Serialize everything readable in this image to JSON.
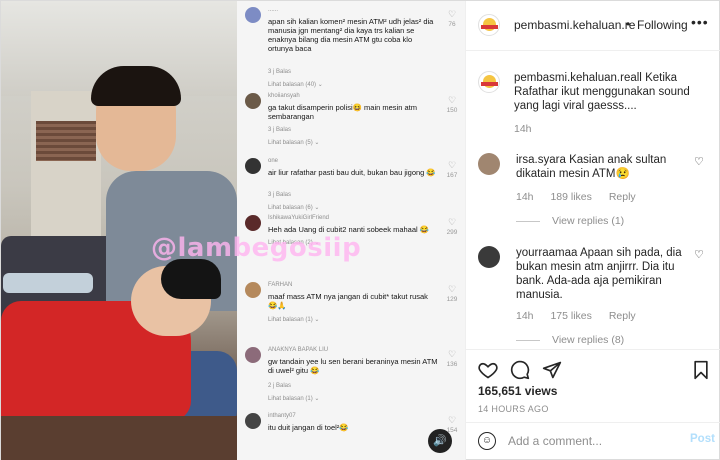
{
  "video": {
    "watermark": "@lambegosiip",
    "comments": [
      {
        "name": "......",
        "text": "apan sih kalian komen² mesin ATM² udh jelas² dia manusia jgn mentang² dia kaya trs kalian se enaknya bilang dia mesin ATM gtu coba klo ortunya baca",
        "meta": "3 j   Balas",
        "more": "Lihat balasan (40) ⌄",
        "likes": "76"
      },
      {
        "name": "khoiiansyah",
        "text": "ga takut disamperin polisi😆 main mesin atm sembarangan",
        "meta": "3 j   Balas",
        "more": "Lihat balasan (5) ⌄",
        "likes": "150"
      },
      {
        "name": "one",
        "text": "air liur rafathar pasti bau duit, bukan bau jigong 😂",
        "meta": "3 j   Balas",
        "more": "Lihat balasan (6) ⌄",
        "likes": "167"
      },
      {
        "name": "IshikawaYukiGirlFriend",
        "text": "Heh ada Uang di cubit2 nanti sobeek mahaal 😂",
        "meta": "",
        "more": "Lihat balasan (2) ⌄",
        "likes": "299"
      },
      {
        "name": "FARHAN",
        "text": "maaf mass ATM nya jangan di cubit* takut rusak 😂🙏",
        "meta": "",
        "more": "Lihat balasan (1) ⌄",
        "likes": "129"
      },
      {
        "name": "ANAKNYA BAPAK LIU",
        "text": "gw tandain yee lu sen berani beraninya mesin ATM di uwel² gitu 😂",
        "meta": "2 j   Balas",
        "more": "Lihat balasan (1) ⌄",
        "likes": "136"
      },
      {
        "name": "inthanty07",
        "text": "itu duit jangan di toel²😂",
        "meta": "",
        "more": "",
        "likes": "154"
      }
    ],
    "sound_icon": "speaker-icon"
  },
  "header": {
    "username": "pembasmi.kehaluan.re",
    "separator": "•",
    "follow_label": "Following",
    "more_icon": "•••"
  },
  "caption": {
    "username": "pembasmi.kehaluan.reall",
    "text": "Ketika Rafathar ikut menggunakan sound yang lagi viral gaesss....",
    "time": "14h"
  },
  "comments": [
    {
      "username": "irsa.syara",
      "text": "Kasian anak sultan dikatain mesin ATM😢",
      "time": "14h",
      "likes": "189 likes",
      "reply": "Reply",
      "view_replies": "View replies (1)"
    },
    {
      "username": "yourraamaa",
      "text": "Apaan sih pada, dia bukan mesin atm anjirrr. Dia itu bank. Ada-ada aja pemikiran manusia.",
      "time": "14h",
      "likes": "175 likes",
      "reply": "Reply",
      "view_replies": "View replies (8)"
    }
  ],
  "actions": {
    "likes": "165,651 views",
    "ago": "14 HOURS AGO",
    "add_placeholder": "Add a comment...",
    "post_label": "Post"
  },
  "colors": {
    "post_disabled": "#b2dffc",
    "muted": "#8e8e8e",
    "watermark": "#ffb4f0"
  }
}
